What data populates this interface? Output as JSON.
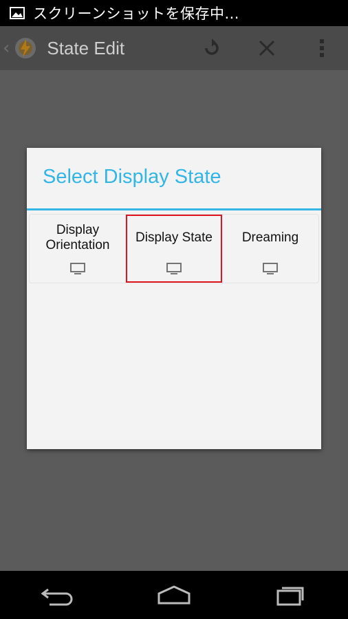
{
  "status_bar": {
    "text": "スクリーンショットを保存中..."
  },
  "app_bar": {
    "title": "State Edit",
    "actions": [
      "refresh-icon",
      "close-icon",
      "overflow-menu-icon"
    ]
  },
  "dialog": {
    "title": "Select Display State",
    "options": [
      {
        "label": "Display\nOrientation",
        "icon": "monitor-icon",
        "selected": false
      },
      {
        "label": "Display State",
        "icon": "monitor-icon",
        "selected": true
      },
      {
        "label": "Dreaming",
        "icon": "monitor-icon",
        "selected": false
      }
    ]
  },
  "nav_bar": {
    "buttons": [
      "back-icon",
      "home-icon",
      "recent-apps-icon"
    ]
  },
  "colors": {
    "accent": "#33b5e5",
    "highlight": "#e0141e"
  }
}
